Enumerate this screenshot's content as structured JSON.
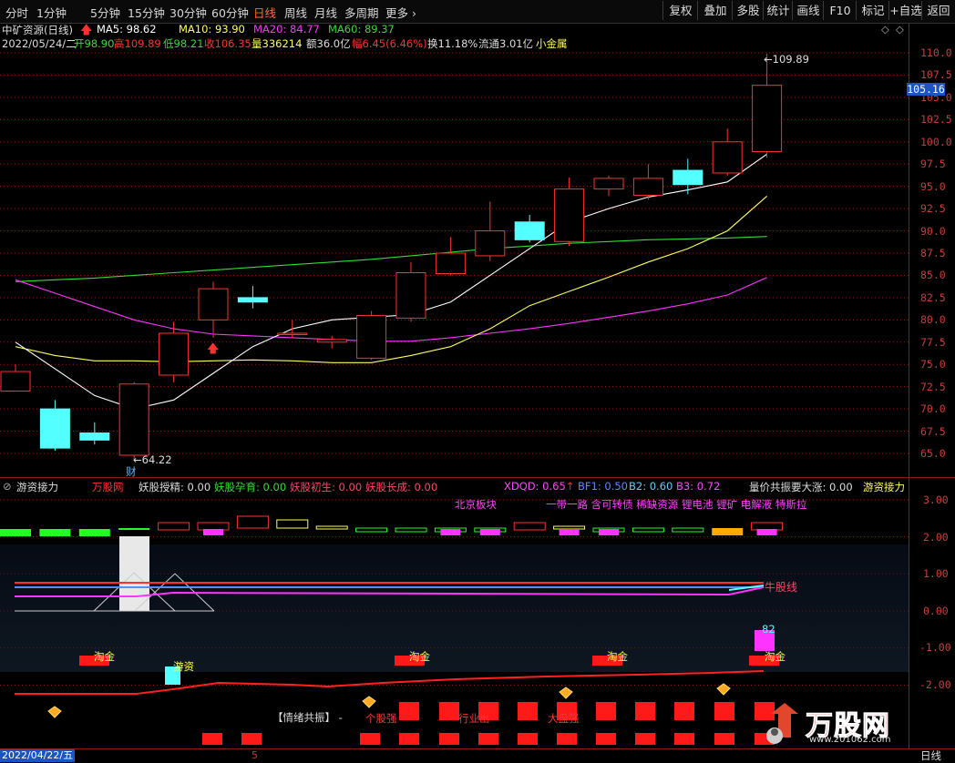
{
  "toolbar": {
    "periods": [
      "分时",
      "1分钟",
      "5分钟",
      "15分钟",
      "30分钟",
      "60分钟",
      "日线",
      "周线",
      "月线",
      "多周期",
      "更多"
    ],
    "active_period": "日线",
    "right_buttons": [
      "复权",
      "叠加",
      "多股",
      "统计",
      "画线",
      "F10",
      "标记",
      "+自选",
      "返回"
    ]
  },
  "info": {
    "stock": "中矿资源(日线)",
    "ma5": "MA5: 98.62",
    "ma10": "MA10: 93.90",
    "ma20": "MA20: 84.77",
    "ma60": "MA60: 89.37",
    "date": "2022/05/24/二",
    "open": "开98.90",
    "high": "高109.89",
    "low": "低98.21",
    "close": "收106.35",
    "vol": "量336214",
    "amount": "额36.0亿",
    "change": "幅6.45(6.46%)",
    "turnover": "换11.18%",
    "float": "流通3.01亿",
    "sector": "小金属"
  },
  "colors": {
    "up": "#ff3030",
    "down": "#54ffff",
    "ma5": "#ffffff",
    "ma10": "#ffff55",
    "ma20": "#ff33ff",
    "ma60": "#33dd33",
    "grid": "#8b1a1a"
  },
  "main_axis": {
    "ticks": [
      "110.0",
      "107.5",
      "105.0",
      "102.5",
      "100.0",
      "97.5",
      "95.0",
      "92.5",
      "90.0",
      "87.5",
      "85.0",
      "82.5",
      "80.0",
      "77.5",
      "75.0",
      "72.5",
      "70.0",
      "67.5",
      "65.0"
    ],
    "current": "105.16"
  },
  "annotations": {
    "high_label": "109.89",
    "low_label": "64.22",
    "cai": "财"
  },
  "chart_data": {
    "type": "candlestick",
    "candles": [
      {
        "o": 72.0,
        "c": 74.2,
        "h": 75.0,
        "l": 72.0
      },
      {
        "o": 70.0,
        "c": 65.6,
        "h": 71.0,
        "l": 65.3
      },
      {
        "o": 67.3,
        "c": 66.5,
        "h": 68.5,
        "l": 66.0
      },
      {
        "o": 64.8,
        "c": 72.8,
        "h": 73.0,
        "l": 64.3
      },
      {
        "o": 73.8,
        "c": 78.5,
        "h": 79.8,
        "l": 73.0
      },
      {
        "o": 80.0,
        "c": 83.5,
        "h": 84.3,
        "l": 78.0
      },
      {
        "o": 82.5,
        "c": 82.0,
        "h": 83.8,
        "l": 81.3
      },
      {
        "o": 78.5,
        "c": 78.5,
        "h": 80.0,
        "l": 78.0
      },
      {
        "o": 77.5,
        "c": 77.8,
        "h": 78.2,
        "l": 76.8
      },
      {
        "o": 75.7,
        "c": 80.5,
        "h": 81.0,
        "l": 75.5
      },
      {
        "o": 80.2,
        "c": 85.3,
        "h": 86.5,
        "l": 79.8
      },
      {
        "o": 85.2,
        "c": 87.5,
        "h": 89.3,
        "l": 85.0
      },
      {
        "o": 87.2,
        "c": 90.0,
        "h": 93.3,
        "l": 86.6
      },
      {
        "o": 91.0,
        "c": 89.0,
        "h": 91.8,
        "l": 88.7
      },
      {
        "o": 88.8,
        "c": 94.7,
        "h": 96.0,
        "l": 88.3
      },
      {
        "o": 94.7,
        "c": 95.9,
        "h": 96.2,
        "l": 93.9
      },
      {
        "o": 94.0,
        "c": 95.9,
        "h": 97.5,
        "l": 93.5
      },
      {
        "o": 96.8,
        "c": 95.2,
        "h": 98.1,
        "l": 94.1
      },
      {
        "o": 96.5,
        "c": 100.0,
        "h": 101.5,
        "l": 96.2
      },
      {
        "o": 98.9,
        "c": 106.35,
        "h": 109.89,
        "l": 98.21
      }
    ],
    "ma5": [
      77.5,
      74.5,
      71.5,
      70.0,
      71.0,
      74.0,
      77.0,
      79.0,
      80.0,
      80.3,
      80.6,
      82.0,
      85.0,
      88.0,
      91.0,
      92.5,
      93.8,
      94.6,
      95.5,
      98.62
    ],
    "ma10": [
      77.0,
      76.0,
      75.4,
      75.4,
      75.3,
      75.4,
      75.5,
      75.4,
      75.2,
      75.2,
      76.0,
      77.0,
      79.0,
      81.6,
      83.2,
      84.8,
      86.5,
      88.0,
      90.0,
      93.9
    ],
    "ma20": [
      84.5,
      83.0,
      81.5,
      80.0,
      79.0,
      78.4,
      78.2,
      78.0,
      77.8,
      77.6,
      77.6,
      78.0,
      78.5,
      79.0,
      79.6,
      80.3,
      81.0,
      81.8,
      82.8,
      84.77
    ],
    "ma60": [
      84.3,
      84.5,
      84.7,
      85.0,
      85.3,
      85.6,
      85.9,
      86.2,
      86.5,
      86.8,
      87.2,
      87.6,
      88.0,
      88.3,
      88.6,
      88.8,
      89.0,
      89.1,
      89.2,
      89.37
    ],
    "ylim": [
      64.0,
      112.0
    ]
  },
  "sub": {
    "title": "游资接力",
    "wg": "万股网",
    "yaoshou": "妖股授精: 0.00",
    "yunyu": "妖股孕育: 0.00",
    "chusheng": "妖股初生: 0.00",
    "zhangcheng": "妖股长成: 0.00",
    "xdqd": "XDQD: 0.65",
    "bf1": "BF1: 0.50",
    "b2": "B2: 0.60",
    "b3": "B3: 0.72",
    "liangjia": "量价共振要大涨: 0.00",
    "right_title": "游资接力",
    "sector_label": "北京板块",
    "concepts": "一带一路 含可转债 稀缺资源 锂电池 锂矿 电解液 特斯拉",
    "niu_line": "牛股线",
    "taojin": "淘金",
    "youzi": "游资",
    "qingxu": "【情绪共振】",
    "gegu": "个股强",
    "hangye": "行业出",
    "dapan": "大盘强",
    "val82": "82",
    "axis": [
      "3.00",
      "2.00",
      "1.00",
      "0.00",
      "-1.00",
      "-2.00"
    ]
  },
  "bottom": {
    "start_date": "2022/04/22/五",
    "mark": "5",
    "period": "日线"
  },
  "watermark": {
    "brand": "万股网",
    "url": "www.201062.com"
  }
}
